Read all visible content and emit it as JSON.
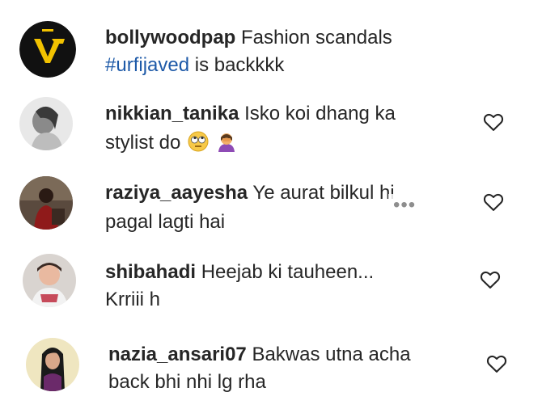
{
  "caption": {
    "username": "bollywoodpap",
    "text_line1": " Fashion scandals",
    "hashtag": "#urfijaved",
    "text_line2_rest": " is backkkk",
    "avatar_icon": "bollywoodpap-logo"
  },
  "comments": [
    {
      "username": "nikkian_tanika",
      "text_line1": " Isko koi dhang ka",
      "text_line2": "stylist do",
      "emojis": [
        "face-with-rolling-eyes-emoji",
        "person-facepalming-emoji"
      ],
      "liked": false
    },
    {
      "username": "raziya_aayesha",
      "text_line1": " Ye aurat bilkul hi",
      "text_line2": "pagal lagti hai",
      "more_indicator": "•••",
      "liked": false
    },
    {
      "username": "shibahadi",
      "text_line1": " Heejab ki tauheen...",
      "text_line2": "Krriii h",
      "liked": false
    },
    {
      "username": "nazia_ansari07",
      "text_line1": " Bakwas utna acha",
      "text_line2": "back bhi nhi lg rha",
      "liked": false
    }
  ],
  "colors": {
    "hashtag": "#1e5aa8",
    "text": "#262626",
    "heart_outline": "#262626"
  }
}
